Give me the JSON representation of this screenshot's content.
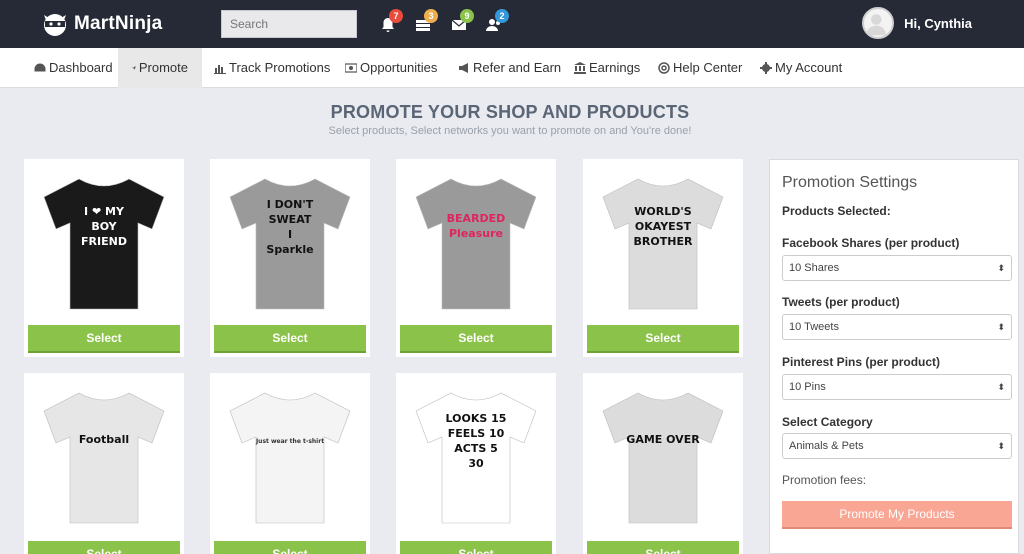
{
  "app": {
    "logo_text": "MartNinja"
  },
  "header": {
    "search_placeholder": "Search",
    "notifications": [
      {
        "icon": "bell-icon",
        "count": "7",
        "color": "#e74c3c"
      },
      {
        "icon": "stack-icon",
        "count": "3",
        "color": "#f0ad4e"
      },
      {
        "icon": "envelope-icon",
        "count": "9",
        "color": "#8bc34a"
      },
      {
        "icon": "users-icon",
        "count": "2",
        "color": "#3498db"
      }
    ],
    "user_greeting": "Hi, Cynthia"
  },
  "nav": {
    "items": [
      {
        "label": "Dashboard",
        "icon": "dashboard-icon"
      },
      {
        "label": "Promote",
        "icon": "send-icon",
        "active": true
      },
      {
        "label": "Track Promotions",
        "icon": "bar-chart-icon"
      },
      {
        "label": "Opportunities",
        "icon": "money-icon"
      },
      {
        "label": "Refer and Earn",
        "icon": "megaphone-icon"
      },
      {
        "label": "Earnings",
        "icon": "bank-icon"
      },
      {
        "label": "Help Center",
        "icon": "lifebuoy-icon"
      },
      {
        "label": "My Account",
        "icon": "gear-icon"
      }
    ]
  },
  "main": {
    "title": "PROMOTE YOUR SHOP AND PRODUCTS",
    "subtitle": "Select products, Select networks you want to promote on and You're done!",
    "select_label": "Select",
    "products": [
      {
        "print_lines": [
          "I ❤ MY",
          "BOY",
          "FRIEND"
        ],
        "shirt_color": "#1a1a1a",
        "ink": "#ffffff"
      },
      {
        "print_lines": [
          "I DON'T",
          "SWEAT",
          "I",
          "Sparkle"
        ],
        "shirt_color": "#9a9a9a",
        "ink": "#111111"
      },
      {
        "print_lines": [
          "BEARDED",
          "Pleasure"
        ],
        "shirt_color": "#9a9a9a",
        "ink": "#e0245e"
      },
      {
        "print_lines": [
          "WORLD'S",
          "OKAYEST",
          "BROTHER"
        ],
        "shirt_color": "#dcdcdc",
        "ink": "#111111"
      },
      {
        "print_lines": [
          "Football"
        ],
        "shirt_color": "#e6e6e6",
        "ink": "#111111"
      },
      {
        "print_lines": [
          "Just wear the t-shirt"
        ],
        "shirt_color": "#f4f4f4",
        "ink": "#333333"
      },
      {
        "print_lines": [
          "LOOKS 15",
          "FEELS 10",
          "ACTS 5",
          "30"
        ],
        "shirt_color": "#ffffff",
        "ink": "#111111"
      },
      {
        "print_lines": [
          "GAME OVER"
        ],
        "shirt_color": "#dcdcdc",
        "ink": "#111111"
      }
    ]
  },
  "settings": {
    "title": "Promotion Settings",
    "products_selected_label": "Products Selected:",
    "facebook_label": "Facebook Shares (per product)",
    "facebook_value": "10 Shares",
    "tweets_label": "Tweets (per product)",
    "tweets_value": "10 Tweets",
    "pins_label": "Pinterest Pins (per product)",
    "pins_value": "10 Pins",
    "category_label": "Select Category",
    "category_value": "Animals & Pets",
    "fees_label": "Promotion fees:",
    "promote_button": "Promote My Products"
  }
}
